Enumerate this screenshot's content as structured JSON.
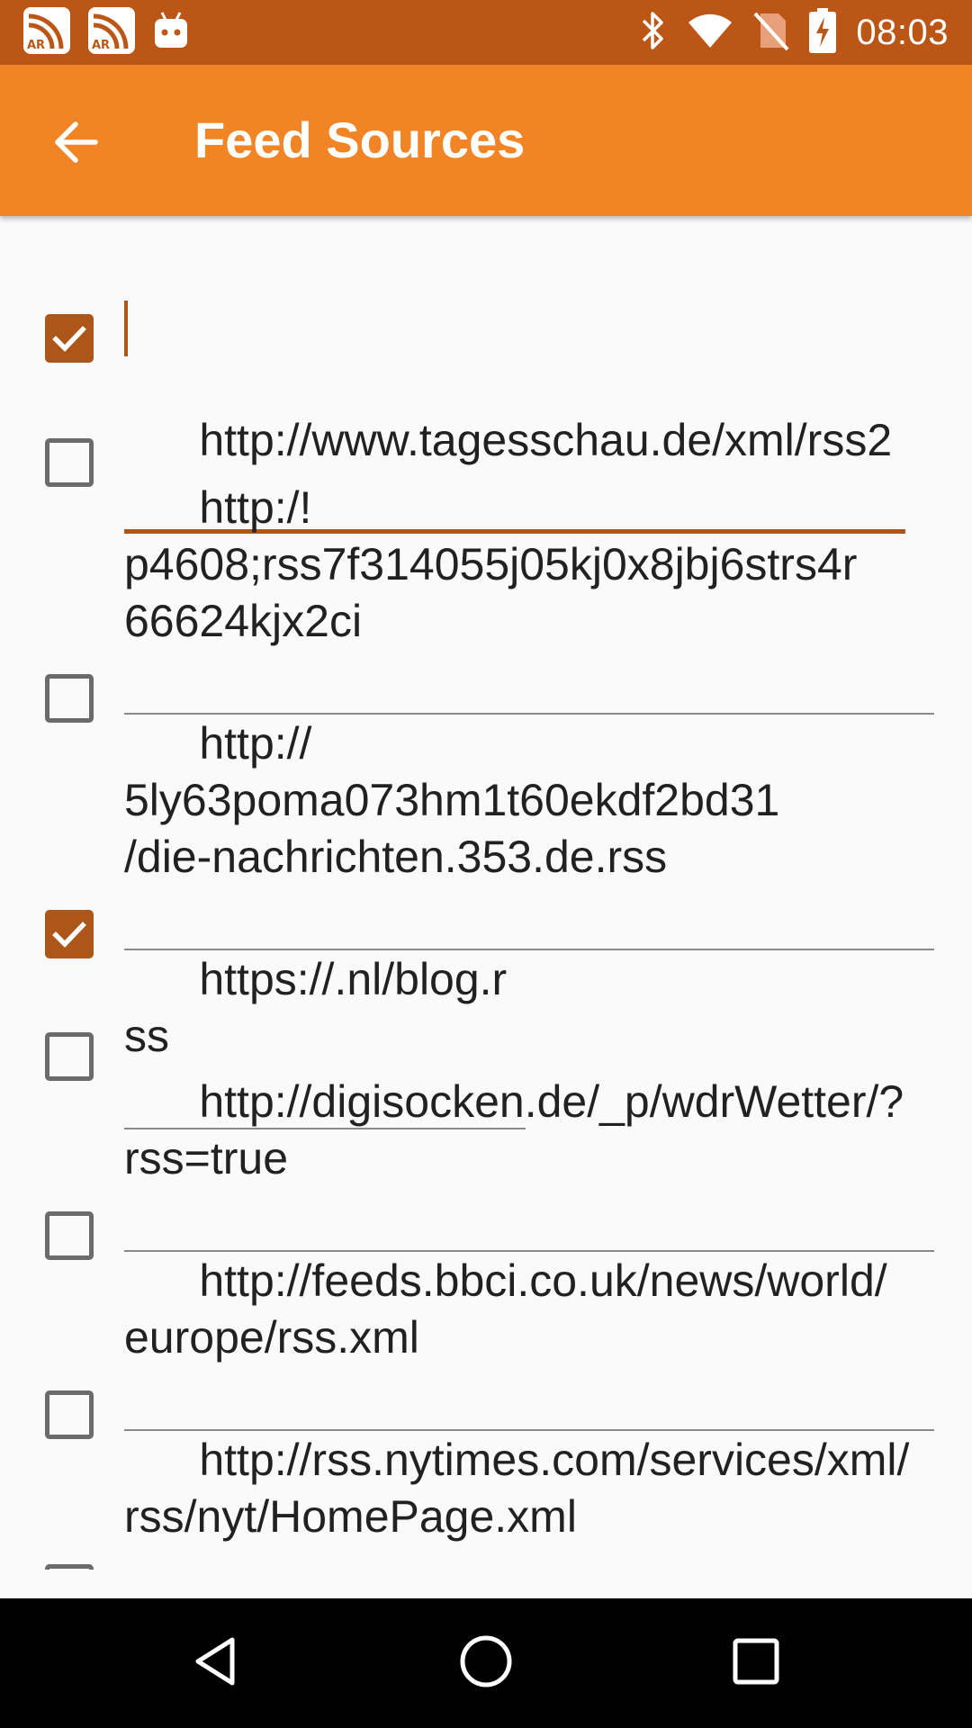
{
  "status_bar": {
    "time": "08:03",
    "left_icons": [
      "ar-feed-icon",
      "ar-feed-icon",
      "android-robot-icon"
    ],
    "right_icons": [
      "bluetooth-icon",
      "wifi-icon",
      "no-sim-icon",
      "battery-charging-icon"
    ]
  },
  "app_bar": {
    "title": "Feed Sources",
    "back_icon": "arrow-back-icon",
    "background_color": "#f18526"
  },
  "colors": {
    "status_bar": "#bb5617",
    "accent": "#ad561a",
    "background": "#fafafa"
  },
  "feeds": [
    {
      "checked": true,
      "url": "http://www.tagesschau.de/xml/rss2",
      "focused": true
    },
    {
      "checked": false,
      "url": "http:/!\np4608;rss7f314055j05kj0x8jbj6strs4r\n66624kjx2ci",
      "focused": false
    },
    {
      "checked": false,
      "url": "http://\n5ly63poma073hm1t60ekdf2bd31\n/die-nachrichten.353.de.rss",
      "focused": false
    },
    {
      "checked": true,
      "url": "https://.nl/blog.rss",
      "focused": false
    },
    {
      "checked": false,
      "url": "http://digisocken.de/_p/wdrWetter/?\nrss=true",
      "focused": false
    },
    {
      "checked": false,
      "url": "http://feeds.bbci.co.uk/news/world/\neurope/rss.xml",
      "focused": false
    },
    {
      "checked": false,
      "url": "http://rss.nytimes.com/services/xml/\nrss/nyt/HomePage.xml",
      "focused": false
    }
  ],
  "nav_bar": {
    "icons": [
      "back-triangle-icon",
      "home-circle-icon",
      "recents-square-icon"
    ]
  }
}
